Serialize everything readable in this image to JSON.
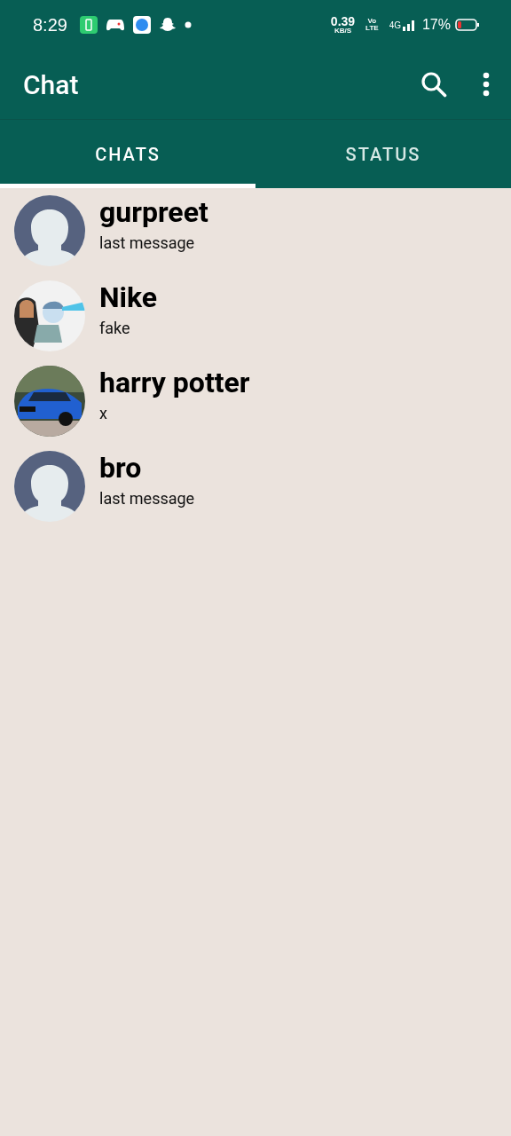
{
  "status_bar": {
    "time": "8:29",
    "speed": "0.39",
    "speed_unit": "KB/S",
    "volte_top": "Vo",
    "volte_bottom": "LTE",
    "network": "4G",
    "battery_percent": "17%"
  },
  "app_bar": {
    "title": "Chat"
  },
  "tabs": [
    {
      "label": "CHATS",
      "selected": true
    },
    {
      "label": "STATUS",
      "selected": false
    }
  ],
  "chats": [
    {
      "name": "gurpreet",
      "message": "last message",
      "avatar": {
        "kind": "default"
      }
    },
    {
      "name": "Nike",
      "message": "fake"
    },
    {
      "name": "harry potter",
      "message": "x"
    },
    {
      "name": "bro",
      "message": "last message",
      "avatar": {
        "kind": "default"
      }
    }
  ]
}
